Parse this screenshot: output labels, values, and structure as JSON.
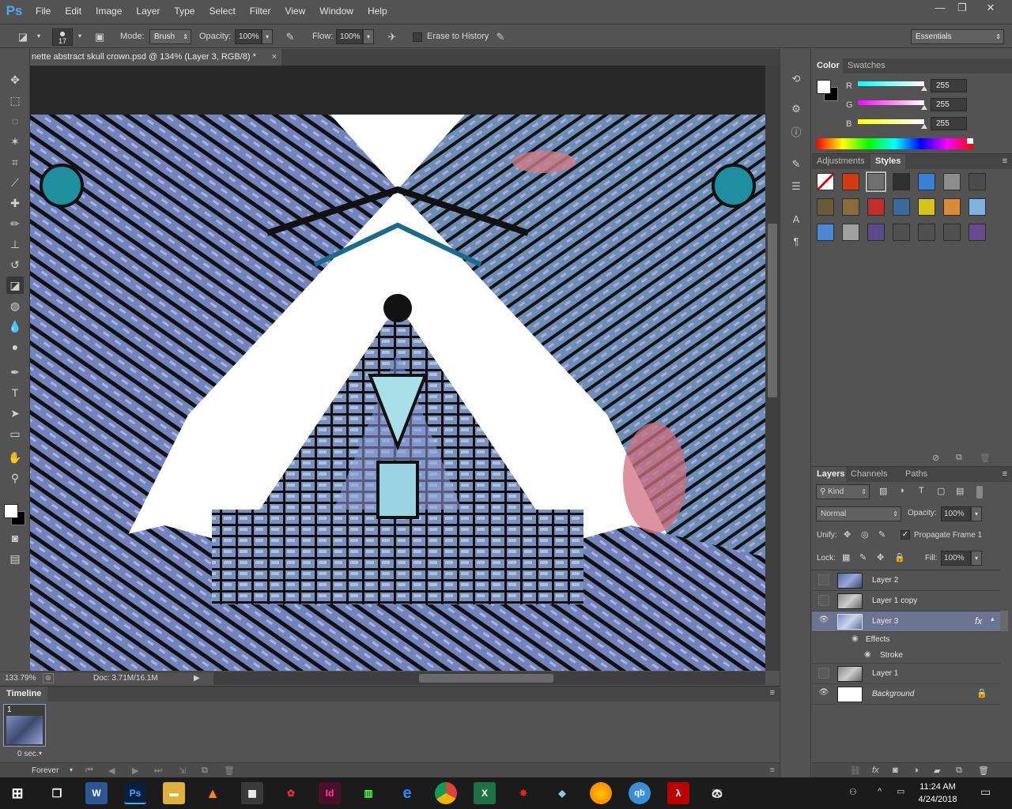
{
  "app": {
    "logo": "Ps"
  },
  "menu": [
    "File",
    "Edit",
    "Image",
    "Layer",
    "Type",
    "Select",
    "Filter",
    "View",
    "Window",
    "Help"
  ],
  "window_controls": {
    "minimize": "—",
    "restore": "❐",
    "close": "✕"
  },
  "options": {
    "brush_size": "17",
    "mode_label": "Mode:",
    "mode_value": "Brush",
    "opacity_label": "Opacity:",
    "opacity_value": "100%",
    "flow_label": "Flow:",
    "flow_value": "100%",
    "erase_history_label": "Erase to History",
    "workspace": "Essentials"
  },
  "document": {
    "tab_title": "nette abstract skull crown.psd @ 134% (Layer 3, RGB/8) *",
    "zoom": "133.79%",
    "doc_size": "Doc: 3.71M/16.1M"
  },
  "timeline": {
    "title": "Timeline",
    "frame_number": "1",
    "frame_delay": "0 sec.",
    "loop": "Forever"
  },
  "color_panel": {
    "tabs": [
      "Color",
      "Swatches"
    ],
    "channels": [
      {
        "label": "R",
        "value": "255",
        "color": "#33e0ff"
      },
      {
        "label": "G",
        "value": "255",
        "color": "#ff33ff"
      },
      {
        "label": "B",
        "value": "255",
        "color": "#ffff33"
      }
    ]
  },
  "styles_panel": {
    "tabs": [
      "Adjustments",
      "Styles"
    ],
    "swatch_colors": [
      [
        "#ffffff",
        "#d43a10",
        "#6f6f6f",
        "#303030",
        "#3a7fd6",
        "#8d8d8d",
        "#4b4b4b"
      ],
      [
        "#6b5a3a",
        "#8a6c3c",
        "#c22d2d",
        "#3a6a9a",
        "#d4c21e",
        "#d98b3a",
        "#7fb3e0"
      ],
      [
        "#4a8ad4",
        "#a0a0a0",
        "#5a4b8c",
        "#505050",
        "#505050",
        "#505050",
        "#6a4a8c"
      ]
    ]
  },
  "layers_panel": {
    "tabs": [
      "Layers",
      "Channels",
      "Paths"
    ],
    "kind": "Kind",
    "blend_mode": "Normal",
    "opacity_label": "Opacity:",
    "opacity_value": "100%",
    "unify_label": "Unify:",
    "propagate_label": "Propagate Frame 1",
    "lock_label": "Lock:",
    "fill_label": "Fill:",
    "fill_value": "100%",
    "layers": [
      {
        "name": "Layer 2",
        "visible": false
      },
      {
        "name": "Layer 1 copy",
        "visible": false
      },
      {
        "name": "Layer 3",
        "visible": true,
        "selected": true,
        "fx": "fx"
      },
      {
        "name": "Effects",
        "kind": "effects-header"
      },
      {
        "name": "Stroke",
        "kind": "effect"
      },
      {
        "name": "Layer 1",
        "visible": false
      },
      {
        "name": "Background",
        "visible": true,
        "locked": true
      }
    ]
  },
  "taskbar": {
    "time": "11:24 AM",
    "date": "4/24/2018"
  }
}
